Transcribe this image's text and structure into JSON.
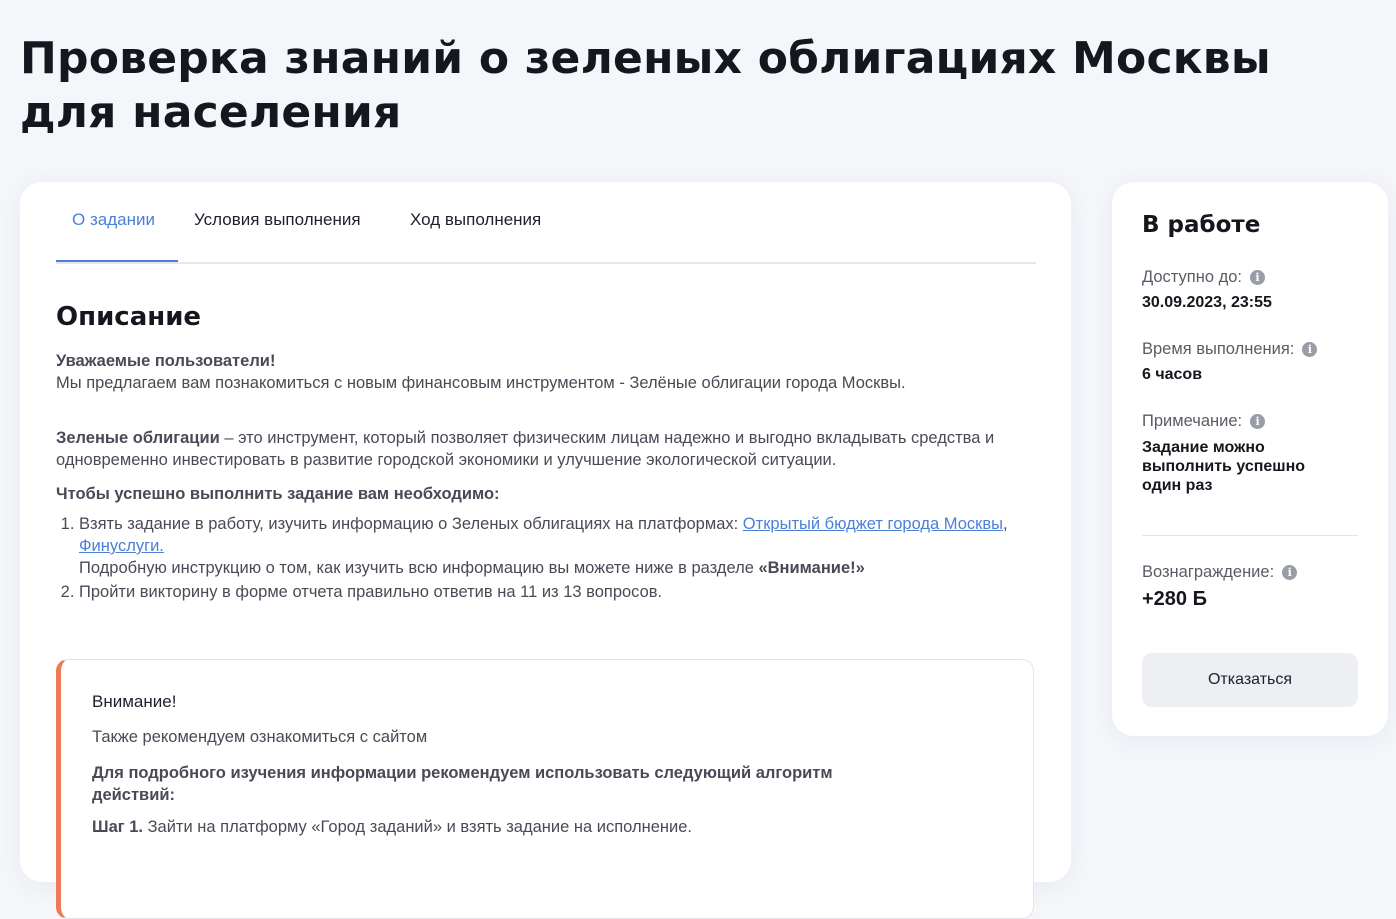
{
  "page_title": "Проверка знаний о зеленых облигациях Москвы для населения",
  "tabs": [
    {
      "label": "О задании",
      "active": true
    },
    {
      "label": "Условия выполнения",
      "active": false
    },
    {
      "label": "Ход выполнения",
      "active": false
    }
  ],
  "description": {
    "title": "Описание",
    "greeting": "Уважаемые пользователи!",
    "intro": "Мы предлагаем вам познакомиться с новым финансовым инструментом - Зелёные облигации города Москвы.",
    "green_bonds_term": "Зеленые облигации",
    "green_bonds_text": " – это инструмент, который позволяет физическим лицам надежно и выгодно вкладывать средства и одновременно инвестировать в развитие городской экономики и улучшение экологической ситуации.",
    "need_title": "Чтобы успешно выполнить задание вам необходимо:",
    "step1_text": "Взять задание в работу, изучить информацию о Зеленых облигациях на платформах: ",
    "link_budget": "Открытый бюджет города Москвы",
    "link_sep": ", ",
    "link_finuslugi": "Финуслуги.",
    "step1_instruction": "Подробную инструкцию о том, как изучить всю информацию вы можете ниже в разделе ",
    "step1_instruction_bold": "«Внимание!»",
    "step2_text": "Пройти викторину в форме отчета правильно ответив на 11 из 13 вопросов."
  },
  "attention": {
    "title": "Внимание!",
    "text": "Также рекомендуем ознакомиться с сайтом",
    "bold_text": "Для подробного изучения информации рекомендуем использовать следующий алгоритм действий:",
    "step_label": "Шаг 1.",
    "step_text": " Зайти на платформу «Город заданий» и взять задание на исполнение.",
    "accent_color": "#ee7b55"
  },
  "sidebar": {
    "status_title": "В работе",
    "available_label": "Доступно до:",
    "available_value": "30.09.2023, 23:55",
    "duration_label": "Время выполнения:",
    "duration_value": "6 часов",
    "note_label": "Примечание:",
    "note_value": "Задание можно выполнить успешно один раз",
    "reward_label": "Вознаграждение:",
    "reward_value": "+280 Б",
    "decline_button": "Отказаться",
    "info_icon_glyph": "i"
  },
  "colors": {
    "accent": "#4b7fd8",
    "attention": "#ee7b55"
  }
}
